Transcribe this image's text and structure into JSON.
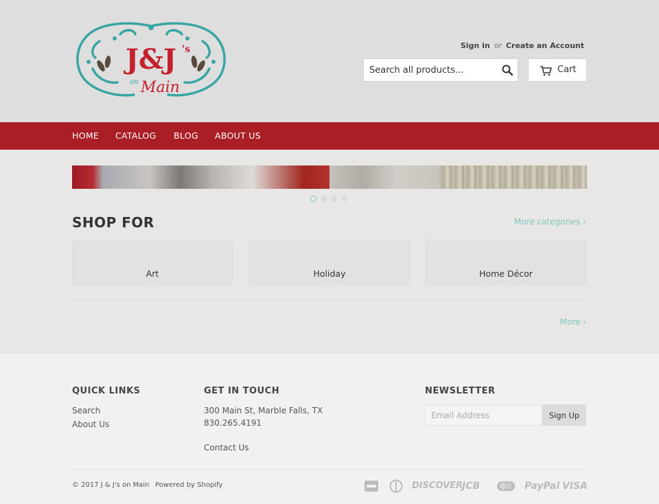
{
  "header": {
    "logo_text": "J&J's on Main",
    "sign_in": "Sign in",
    "or": "or",
    "create_account": "Create an Account",
    "search_placeholder": "Search all products...",
    "cart_label": "Cart"
  },
  "nav": {
    "items": [
      {
        "label": "HOME"
      },
      {
        "label": "CATALOG"
      },
      {
        "label": "BLOG"
      },
      {
        "label": "ABOUT US"
      }
    ]
  },
  "slideshow": {
    "slide_count": 4,
    "active_index": 0
  },
  "shop_for": {
    "title": "SHOP FOR",
    "more_categories": "More categories ›",
    "categories": [
      {
        "label": "Art"
      },
      {
        "label": "Holiday"
      },
      {
        "label": "Home Décor"
      }
    ],
    "more": "More ›"
  },
  "footer": {
    "quick_links": {
      "title": "QUICK LINKS",
      "items": [
        {
          "label": "Search"
        },
        {
          "label": "About Us"
        }
      ]
    },
    "get_in_touch": {
      "title": "GET IN TOUCH",
      "address": "300 Main St, Marble Falls, TX",
      "phone": "830.265.4191",
      "contact": "Contact Us"
    },
    "newsletter": {
      "title": "NEWSLETTER",
      "email_placeholder": "Email Address",
      "signup_label": "Sign Up"
    },
    "copyright": "© 2017 J & J's on Main",
    "powered_by": "Powered by Shopify",
    "payment_methods": [
      {
        "name": "american-express-icon"
      },
      {
        "name": "diners-club-icon"
      },
      {
        "name": "discover-icon",
        "label": "DISCOVER"
      },
      {
        "name": "jcb-icon",
        "label": "JCB"
      },
      {
        "name": "master-icon"
      },
      {
        "name": "paypal-icon",
        "label": "PayPal"
      },
      {
        "name": "visa-icon",
        "label": "VISA"
      }
    ]
  },
  "colors": {
    "nav_red": "#aa1e26",
    "accent_teal": "#7ec6bf",
    "logo_red": "#c5202e",
    "logo_teal": "#3aa6a3"
  }
}
